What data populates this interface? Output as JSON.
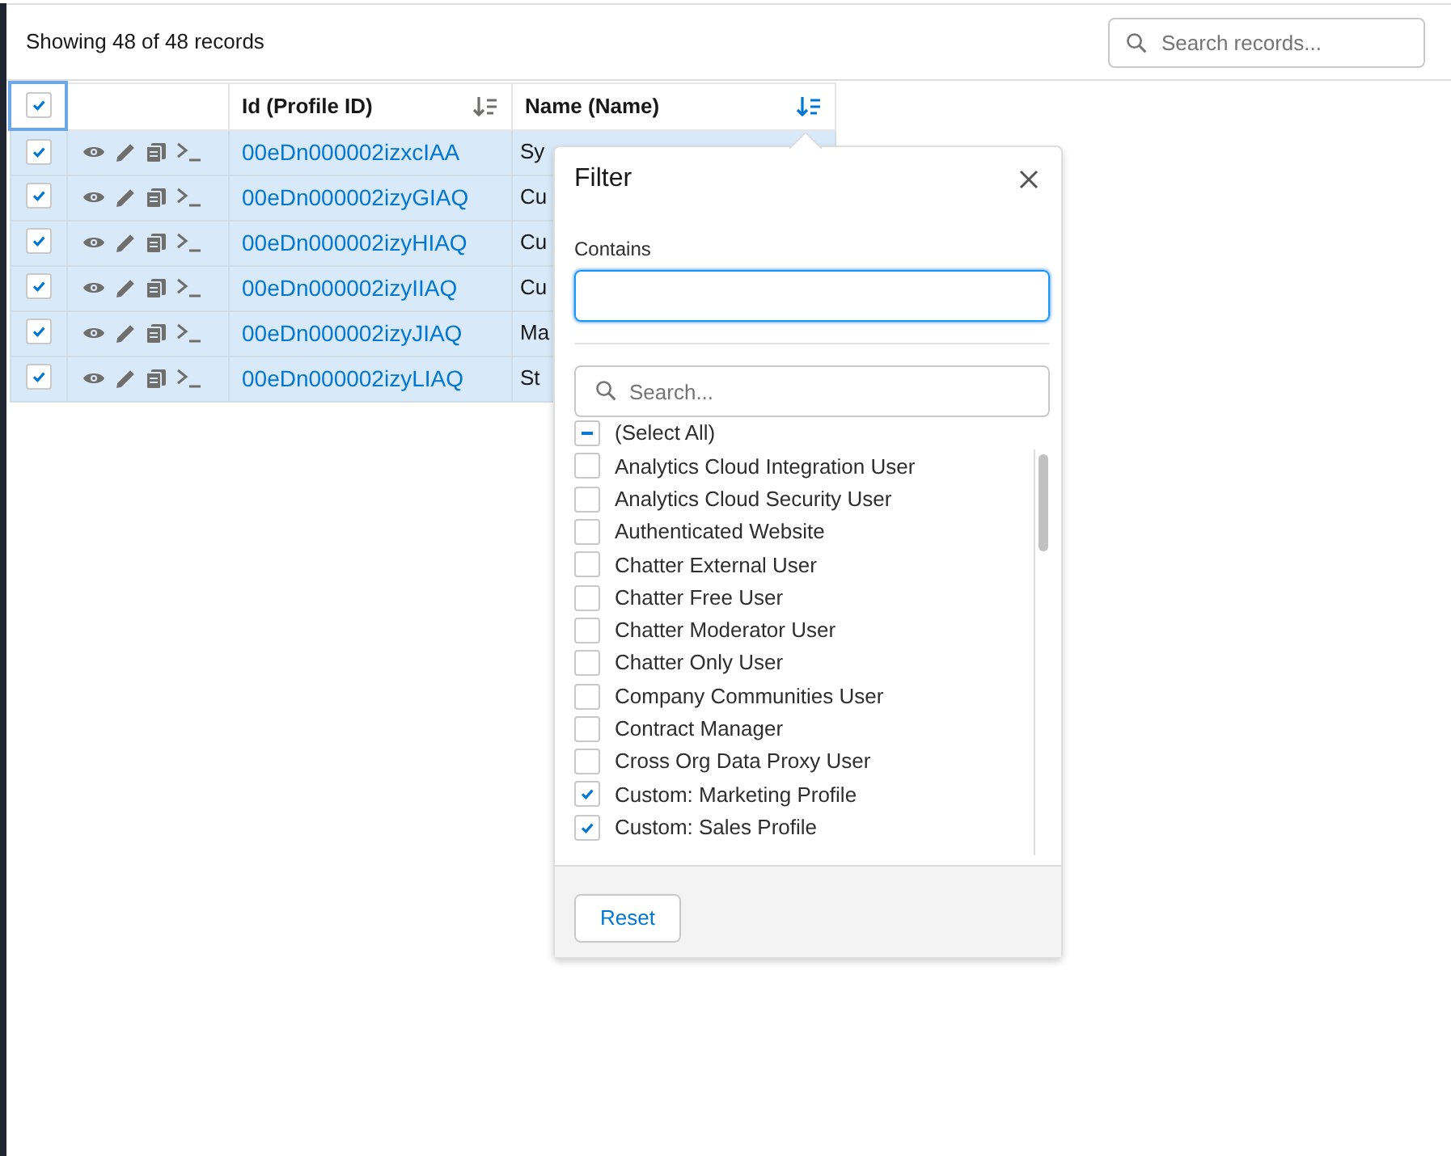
{
  "summary": "Showing 48 of 48 records",
  "search": {
    "placeholder": "Search records..."
  },
  "table": {
    "header_checked": true,
    "columns": [
      {
        "label": "Id (Profile ID)",
        "sort_active": false
      },
      {
        "label": "Name (Name)",
        "sort_active": true
      }
    ],
    "rows": [
      {
        "checked": true,
        "id": "00eDn000002izxcIAA",
        "name": "Sy"
      },
      {
        "checked": true,
        "id": "00eDn000002izyGIAQ",
        "name": "Cu"
      },
      {
        "checked": true,
        "id": "00eDn000002izyHIAQ",
        "name": "Cu"
      },
      {
        "checked": true,
        "id": "00eDn000002izyIIAQ",
        "name": "Cu"
      },
      {
        "checked": true,
        "id": "00eDn000002izyJIAQ",
        "name": "Ma"
      },
      {
        "checked": true,
        "id": "00eDn000002izyLIAQ",
        "name": "St"
      }
    ]
  },
  "filter": {
    "title": "Filter",
    "contains_label": "Contains",
    "search_placeholder": "Search...",
    "select_all": {
      "label": "(Select All)",
      "indeterminate": true
    },
    "options": [
      {
        "label": "Analytics Cloud Integration User",
        "checked": false
      },
      {
        "label": "Analytics Cloud Security User",
        "checked": false
      },
      {
        "label": "Authenticated Website",
        "checked": false
      },
      {
        "label": "Chatter External User",
        "checked": false
      },
      {
        "label": "Chatter Free User",
        "checked": false
      },
      {
        "label": "Chatter Moderator User",
        "checked": false
      },
      {
        "label": "Chatter Only User",
        "checked": false
      },
      {
        "label": "Company Communities User",
        "checked": false
      },
      {
        "label": "Contract Manager",
        "checked": false
      },
      {
        "label": "Cross Org Data Proxy User",
        "checked": false
      },
      {
        "label": "Custom: Marketing Profile",
        "checked": true
      },
      {
        "label": "Custom: Sales Profile",
        "checked": true
      }
    ],
    "reset_label": "Reset"
  }
}
